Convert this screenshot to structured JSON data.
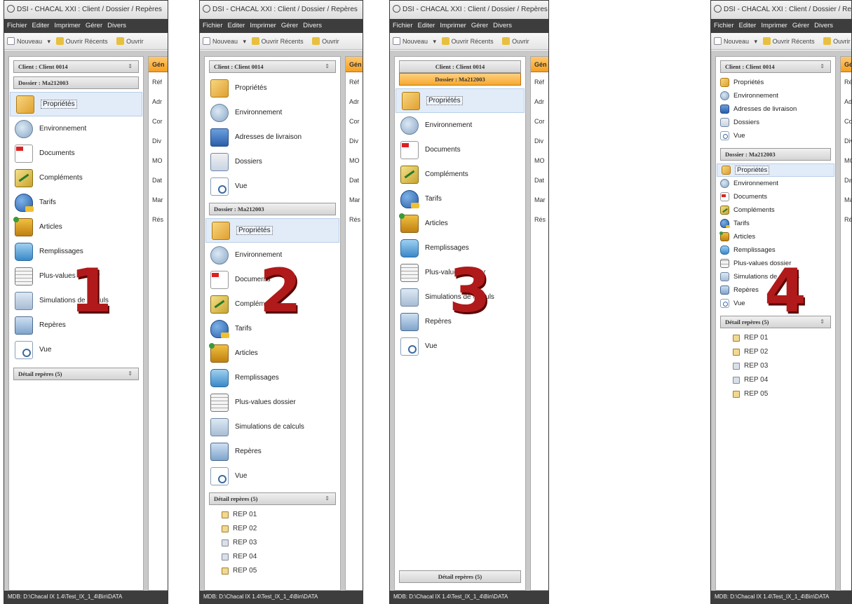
{
  "window": {
    "title": "DSI - CHACAL XXI : Client / Dossier / Repères",
    "menu": [
      "Fichier",
      "Editer",
      "Imprimer",
      "Gérer",
      "Divers"
    ],
    "toolbar": {
      "new": "Nouveau",
      "recent": "Ouvrir Récents",
      "open": "Ouvrir"
    },
    "status": "MDB: D:\\Chacal IX 1.4\\Test_IX_1_4\\Bin\\DATA"
  },
  "labels": {
    "client": "Client : Client 0014",
    "dossier": "Dossier : Ma212003",
    "detail": "Détail repères (5)"
  },
  "client_items": [
    "Propriétés",
    "Environnement",
    "Adresses de livraison",
    "Dossiers",
    "Vue"
  ],
  "dossier_items": [
    "Propriétés",
    "Environnement",
    "Documents",
    "Compléments",
    "Tarifs",
    "Articles",
    "Remplissages",
    "Plus-values dossier",
    "Simulations de calculs",
    "Repères",
    "Vue"
  ],
  "reperes": [
    "REP 01",
    "REP 02",
    "REP 03",
    "REP 04",
    "REP 05"
  ],
  "right_panel": {
    "header": "Gén",
    "items": [
      "Réf",
      "Adr",
      "Cor",
      "Div",
      "MO",
      "Dat",
      "Mar",
      "Rés"
    ]
  },
  "numbers": [
    "1",
    "2",
    "3",
    "4"
  ],
  "colors": {
    "accent_orange": "#f5a020",
    "status_bar": "#3d3d3d",
    "number_red": "#b01a1a"
  }
}
